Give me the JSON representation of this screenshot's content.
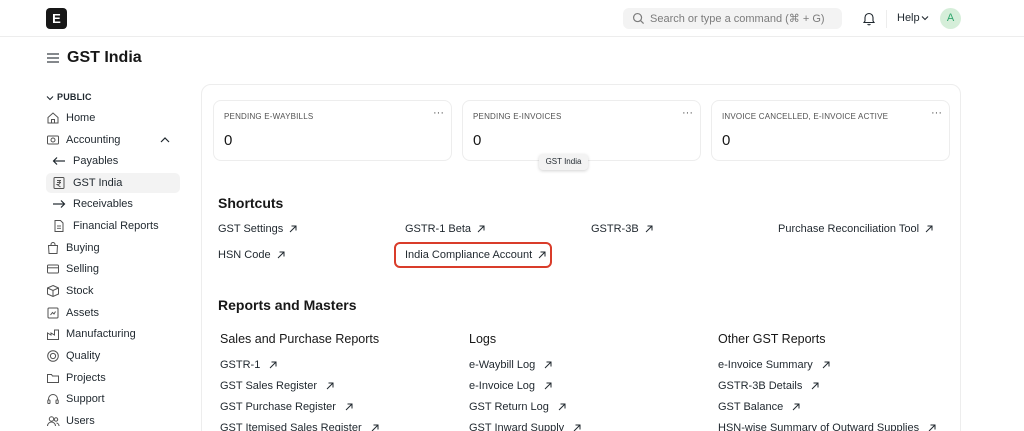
{
  "navbar": {
    "logo_letter": "E",
    "search_placeholder": "Search or type a command (⌘ + G)",
    "help_label": "Help",
    "avatar_letter": "A"
  },
  "page": {
    "title": "GST India"
  },
  "sidebar": {
    "section_label": "PUBLIC",
    "items": [
      {
        "label": "Home",
        "icon": "home-icon"
      },
      {
        "label": "Accounting",
        "icon": "accounting-icon"
      },
      {
        "label": "Payables",
        "icon": "arrow-left-icon"
      },
      {
        "label": "GST India",
        "icon": "rupee-icon"
      },
      {
        "label": "Receivables",
        "icon": "arrow-right-icon"
      },
      {
        "label": "Financial Reports",
        "icon": "file-icon"
      },
      {
        "label": "Buying",
        "icon": "bag-icon"
      },
      {
        "label": "Selling",
        "icon": "card-icon"
      },
      {
        "label": "Stock",
        "icon": "box-icon"
      },
      {
        "label": "Assets",
        "icon": "assets-icon"
      },
      {
        "label": "Manufacturing",
        "icon": "factory-icon"
      },
      {
        "label": "Quality",
        "icon": "quality-icon"
      },
      {
        "label": "Projects",
        "icon": "folder-icon"
      },
      {
        "label": "Support",
        "icon": "support-icon"
      },
      {
        "label": "Users",
        "icon": "users-icon"
      }
    ]
  },
  "number_cards": [
    {
      "label": "PENDING E-WAYBILLS",
      "value": "0"
    },
    {
      "label": "PENDING E-INVOICES",
      "value": "0"
    },
    {
      "label": "INVOICE CANCELLED, E-INVOICE ACTIVE",
      "value": "0"
    }
  ],
  "tooltip": "GST India",
  "shortcuts": {
    "title": "Shortcuts",
    "items": [
      "GST Settings",
      "GSTR-1 Beta",
      "GSTR-3B",
      "Purchase Reconciliation Tool",
      "HSN Code",
      "India Compliance Account"
    ]
  },
  "reports": {
    "title": "Reports and Masters",
    "columns": [
      {
        "title": "Sales and Purchase Reports",
        "links": [
          "GSTR-1",
          "GST Sales Register",
          "GST Purchase Register",
          "GST Itemised Sales Register"
        ]
      },
      {
        "title": "Logs",
        "links": [
          "e-Waybill Log",
          "e-Invoice Log",
          "GST Return Log",
          "GST Inward Supply"
        ]
      },
      {
        "title": "Other GST Reports",
        "links": [
          "e-Invoice Summary",
          "GSTR-3B Details",
          "GST Balance",
          "HSN-wise Summary of Outward Supplies"
        ]
      }
    ]
  },
  "colors": {
    "highlight": "#d93c2a",
    "text": "#1f272e",
    "muted": "#7c7c7c"
  }
}
